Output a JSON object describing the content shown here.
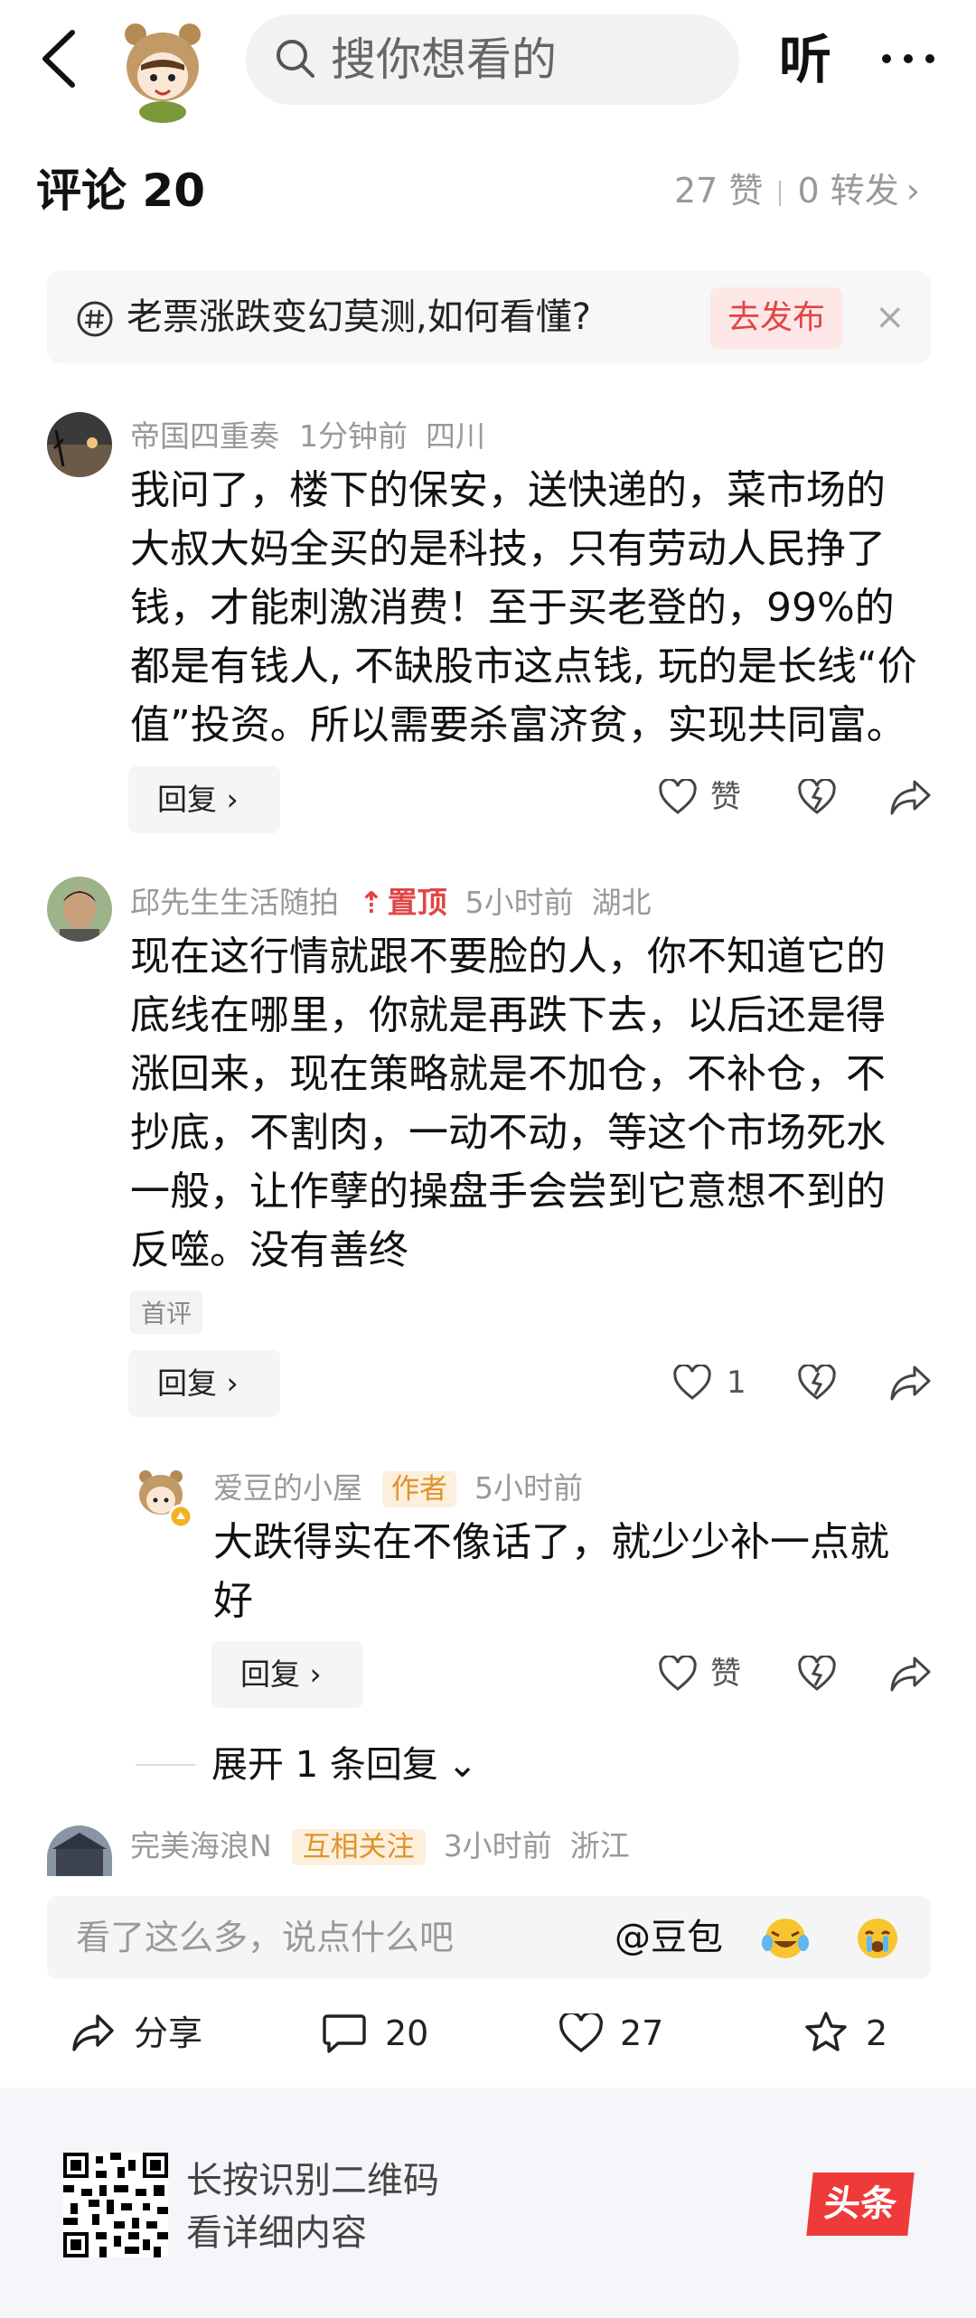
{
  "header": {
    "search_placeholder": "搜你想看的",
    "listen_label": "听"
  },
  "comments_header": {
    "title": "评论 20",
    "likes": "27 赞",
    "reposts": "0 转发"
  },
  "topic": {
    "text": "老票涨跌变幻莫测,如何看懂?",
    "button": "去发布",
    "close": "×"
  },
  "comments": [
    {
      "name": "帝国四重奏",
      "time": "1分钟前",
      "location": "四川",
      "lines": [
        "我问了，楼下的保安，送快递的，菜市场的",
        "大叔大妈全买的是科技，只有劳动人民挣了",
        "钱，才能刺激消费！至于买老登的，99%的",
        "都是有钱人, 不缺股市这点钱, 玩的是长线“价",
        "值”投资。所以需要杀富济贫，实现共同富。"
      ],
      "reply": "回复 ›",
      "like": "赞"
    },
    {
      "name": "邱先生生活随拍",
      "pinned": "置顶",
      "time": "5小时前",
      "location": "湖北",
      "lines": [
        "现在这行情就跟不要脸的人，你不知道它的",
        "底线在哪里，你就是再跌下去，以后还是得",
        "涨回来，现在策略就是不加仓，不补仓，不",
        "抄底，不割肉，一动不动，等这个市场死水",
        "一般，让作孽的操盘手会尝到它意想不到的",
        "反噬。没有善终"
      ],
      "tag": "首评",
      "reply": "回复 ›",
      "like": "1"
    },
    {
      "name": "爱豆的小屋",
      "badge": "作者",
      "time": "5小时前",
      "lines": [
        "大跌得实在不像话了，就少少补一点就",
        "好"
      ],
      "reply": "回复 ›",
      "like": "赞",
      "expand": "展开 1 条回复"
    },
    {
      "name": "完美海浪N",
      "badge": "互相关注",
      "time": "3小时前",
      "location": "浙江"
    }
  ],
  "input": {
    "placeholder": "看了这么多，说点什么吧",
    "mention": "@豆包"
  },
  "bottom_bar": {
    "share": "分享",
    "comments": "20",
    "likes": "27",
    "favorites": "2"
  },
  "footer": {
    "line1": "长按识别二维码",
    "line2": "看详细内容",
    "brand": "头条"
  }
}
